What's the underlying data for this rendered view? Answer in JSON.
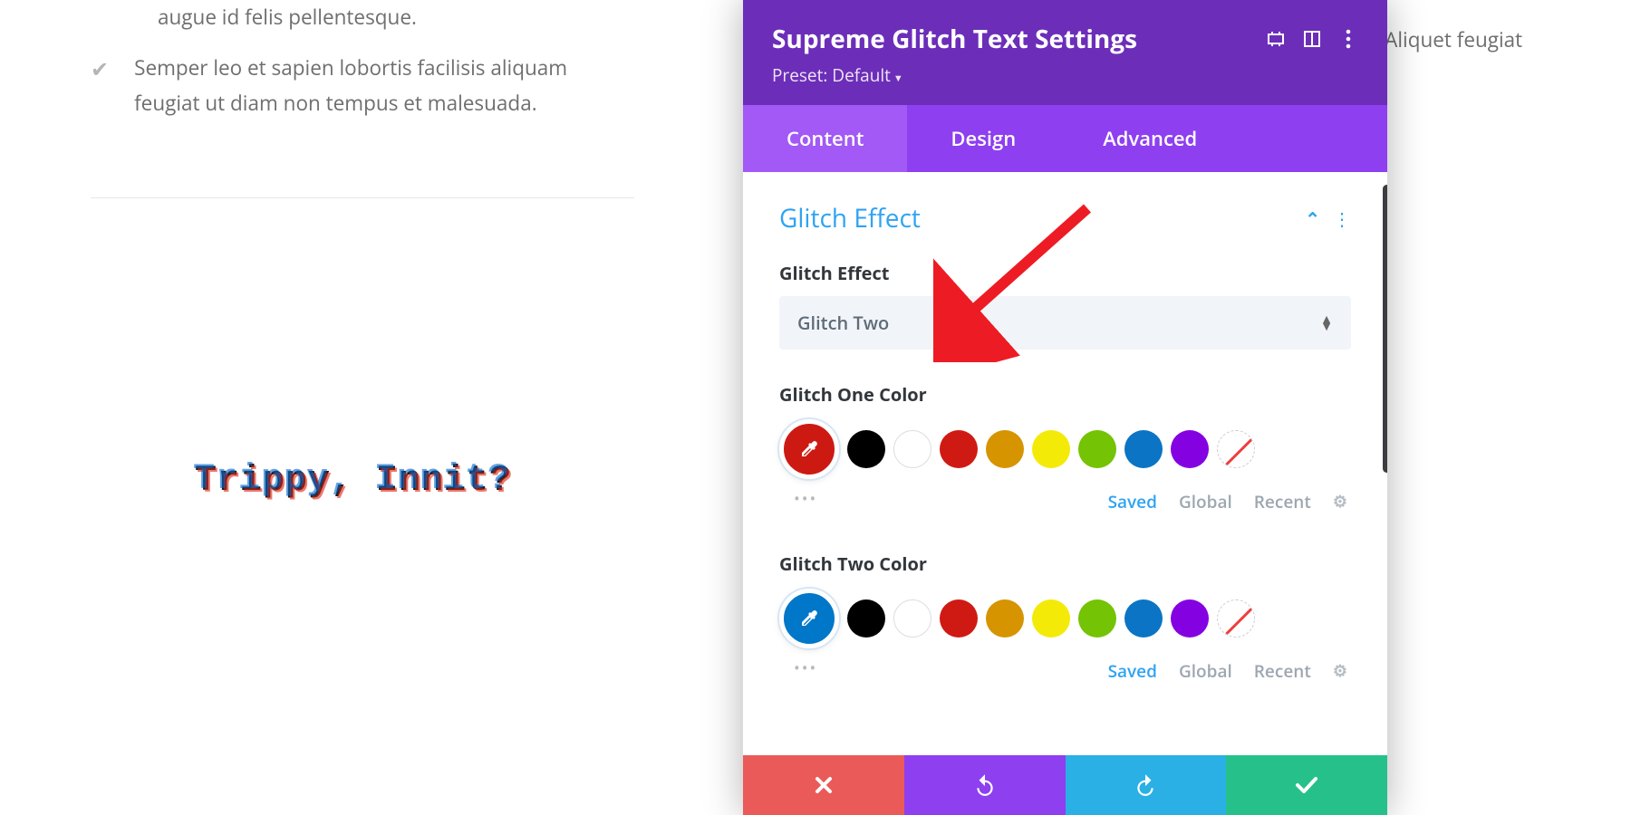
{
  "bg": {
    "item1": "augue id felis pellentesque.",
    "item2": "Semper leo et sapien lobortis facilisis aliquam feugiat ut diam non tempus et malesuada.",
    "rightItem": "Aliquet feugiat",
    "glitch": "Trippy, Innit?"
  },
  "panel": {
    "title": "Supreme Glitch Text Settings",
    "preset": "Preset: Default",
    "tabs": {
      "content": "Content",
      "design": "Design",
      "advanced": "Advanced"
    },
    "section": "Glitch Effect",
    "fields": {
      "effectLabel": "Glitch Effect",
      "effectValue": "Glitch Two",
      "color1Label": "Glitch One Color",
      "color2Label": "Glitch Two Color"
    },
    "paletteTabs": {
      "saved": "Saved",
      "global": "Global",
      "recent": "Recent"
    },
    "swatches": [
      "black",
      "white",
      "red",
      "orange",
      "yellow",
      "green",
      "blue",
      "purple",
      "none"
    ]
  }
}
